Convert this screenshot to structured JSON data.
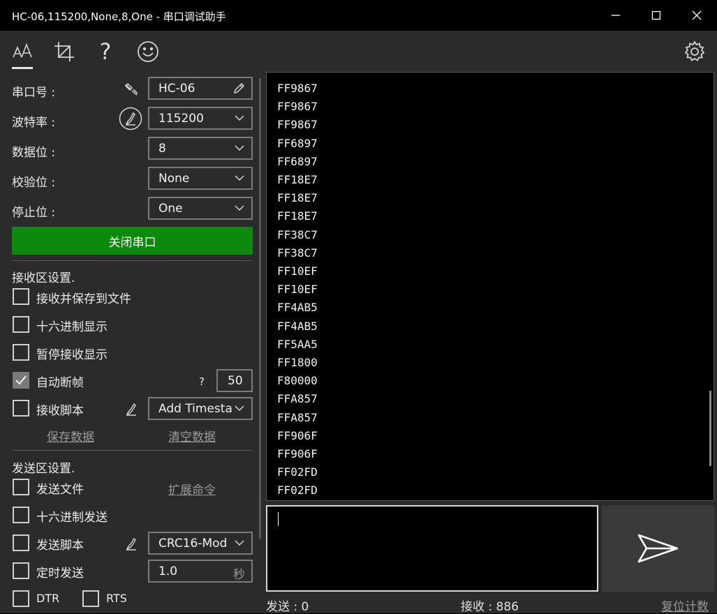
{
  "window": {
    "title": "HC-06,115200,None,8,One - 串口调试助手",
    "minimize": "—",
    "maximize": "☐",
    "close": "✕"
  },
  "toolbar": {
    "icons": [
      "font-size-icon",
      "crop-icon",
      "help-icon",
      "smiley-icon",
      "settings-icon"
    ],
    "help_glyph": "?"
  },
  "serial": {
    "port_label": "串口号 :",
    "port_value": "HC-06",
    "baud_label": "波特率 :",
    "baud_value": "115200",
    "databits_label": "数据位 :",
    "databits_value": "8",
    "parity_label": "校验位 :",
    "parity_value": "None",
    "stopbits_label": "停止位 :",
    "stopbits_value": "One",
    "toggle_button": "关闭串口"
  },
  "receive": {
    "section_title": "接收区设置.",
    "save_to_file": "接收并保存到文件",
    "hex_display": "十六进制显示",
    "pause_display": "暂停接收显示",
    "auto_frame": "自动断帧",
    "auto_frame_checked": true,
    "frame_help": "?",
    "frame_value": "50",
    "script_label": "接收脚本",
    "script_value": "Add Timesta",
    "save_data": "保存数据",
    "clear_data": "清空数据"
  },
  "send": {
    "section_title": "发送区设置.",
    "send_file": "发送文件",
    "extend_cmd": "扩展命令",
    "hex_send": "十六进制发送",
    "script_label": "发送脚本",
    "script_value": "CRC16-Mod",
    "timed_send": "定时发送",
    "interval_value": "1.0",
    "interval_unit": "秒",
    "dtr": "DTR",
    "rts": "RTS"
  },
  "received_lines": [
    "FF9867",
    "FF9867",
    "FF9867",
    "FF6897",
    "FF6897",
    "FF18E7",
    "FF18E7",
    "FF18E7",
    "FF38C7",
    "FF38C7",
    "FF10EF",
    "FF10EF",
    "FF4AB5",
    "FF4AB5",
    "FF5AA5",
    "FF1800",
    "F80000",
    "FFA857",
    "FFA857",
    "FF906F",
    "FF906F",
    "FF02FD",
    "FF02FD"
  ],
  "status": {
    "sent": "发送 : 0",
    "received": "接收 : 886",
    "reset": "复位计数"
  },
  "colors": {
    "accent_green": "#0d8a0d",
    "panel_bg": "#2b2b2b",
    "terminal_bg": "#000000"
  }
}
